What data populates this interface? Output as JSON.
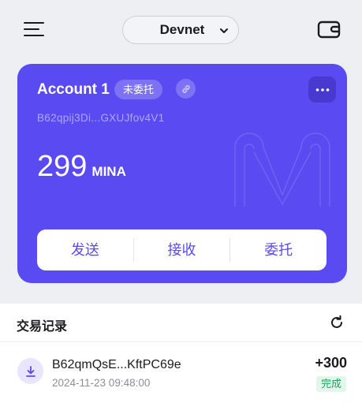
{
  "header": {
    "menu_icon": "hamburger-menu-icon",
    "network": "Devnet",
    "network_icon": "chevron-down-icon",
    "wallet_icon": "wallet-icon"
  },
  "account_card": {
    "name": "Account 1",
    "delegation_badge": "未委托",
    "link_icon": "link-icon",
    "more_icon": "more-dots-icon",
    "address": "B62qpij3Di...GXUJfov4V1",
    "balance": "299",
    "unit": "MINA",
    "accent_color": "#594af1",
    "actions": {
      "send": "发送",
      "receive": "接收",
      "delegate": "委托"
    }
  },
  "history": {
    "title": "交易记录",
    "refresh_icon": "refresh-icon",
    "transactions": [
      {
        "direction_icon": "receive-download-icon",
        "address": "B62qmQsE...KftPC69e",
        "time": "2024-11-23 09:48:00",
        "amount": "+300",
        "status": "完成",
        "status_color": "#1fa35c"
      }
    ]
  }
}
